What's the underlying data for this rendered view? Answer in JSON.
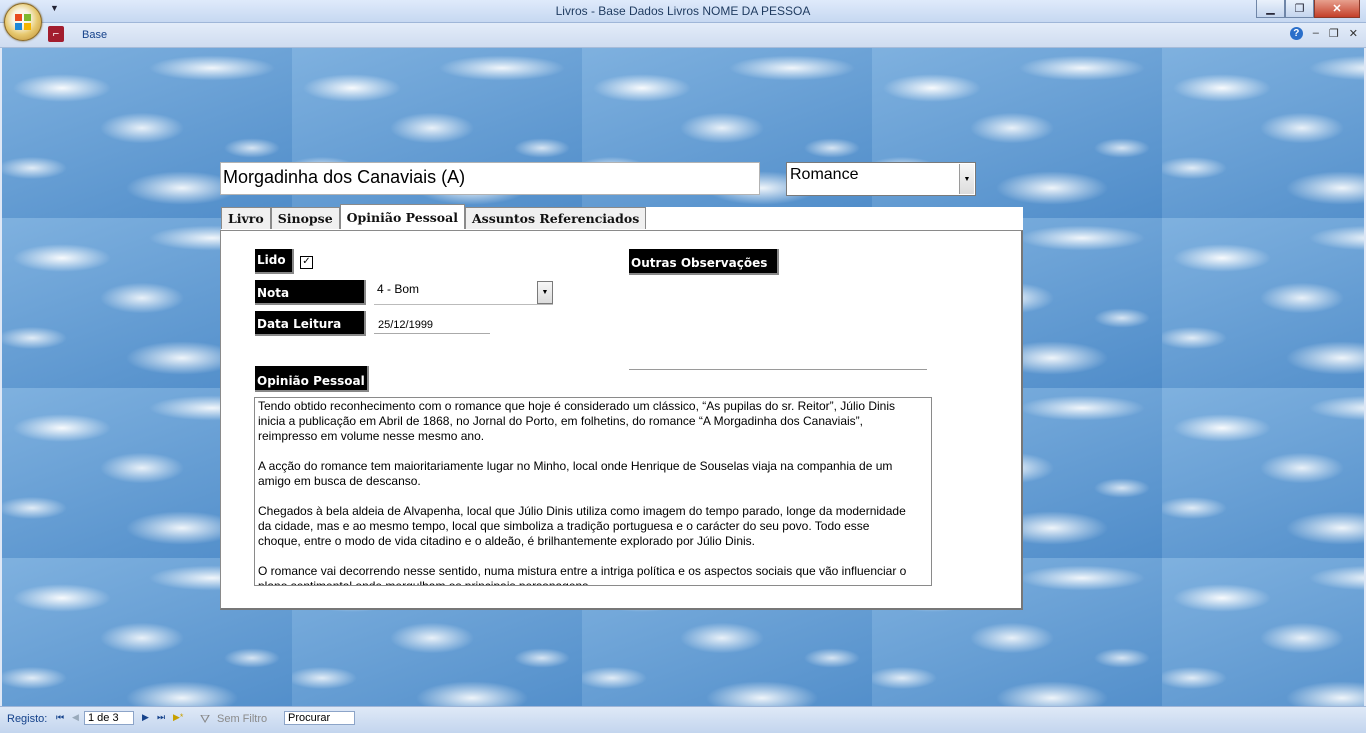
{
  "window": {
    "title": "Livros - Base Dados Livros NOME DA PESSOA",
    "minimize": "▁",
    "maximize": "❐",
    "close": "✕"
  },
  "ribbon": {
    "tab_base": "Base",
    "help": "?",
    "min": "‒",
    "restore": "❐",
    "close": "✕"
  },
  "record": {
    "title": "Morgadinha dos Canaviais (A)",
    "genre": "Romance"
  },
  "tabs": [
    {
      "label": "Livro"
    },
    {
      "label": "Sinopse"
    },
    {
      "label": "Opinião Pessoal"
    },
    {
      "label": "Assuntos Referenciados"
    }
  ],
  "form": {
    "lido_label": "Lido",
    "lido_checked": "✓",
    "nota_label": "Nota",
    "nota_value": "4 - Bom",
    "data_label": "Data Leitura",
    "data_value": "25/12/1999",
    "outras_label": "Outras Observações",
    "opiniao_label": "Opinião Pessoal",
    "opiniao_text": "Tendo obtido reconhecimento com o romance que hoje é considerado um clássico, “As pupilas do sr. Reitor”, Júlio Dinis inicia a publicação em Abril de 1868, no Jornal do Porto, em folhetins, do romance “A Morgadinha dos Canaviais”, reimpresso em volume nesse mesmo ano.\n\nA acção do romance tem maioritariamente lugar no Minho, local onde Henrique de Souselas viaja na companhia de um amigo em busca de descanso.\n\nChegados à bela aldeia de Alvapenha, local que Júlio Dinis utiliza como imagem do tempo parado, longe da modernidade da cidade, mas e ao mesmo tempo, local que simboliza a tradição portuguesa e o carácter do seu povo. Todo esse choque, entre o modo de vida citadino e o aldeão, é brilhantemente explorado por Júlio Dinis.\n\nO romance vai decorrendo nesse sentido, numa mistura entre a intriga política e os aspectos sociais que vão influenciar o plano sentimental onde mergulham os principais personagens."
  },
  "statusbar": {
    "registo_label": "Registo:",
    "first": "⏮",
    "prev": "◀",
    "record_pos": "1 de 3",
    "next": "▶",
    "last": "⏭",
    "new": "▶*",
    "filter_label": "Sem Filtro",
    "search_placeholder": "Procurar"
  },
  "icons": {
    "office": "office-logo-icon",
    "access": "access-app-icon",
    "filter": "funnel-icon"
  }
}
